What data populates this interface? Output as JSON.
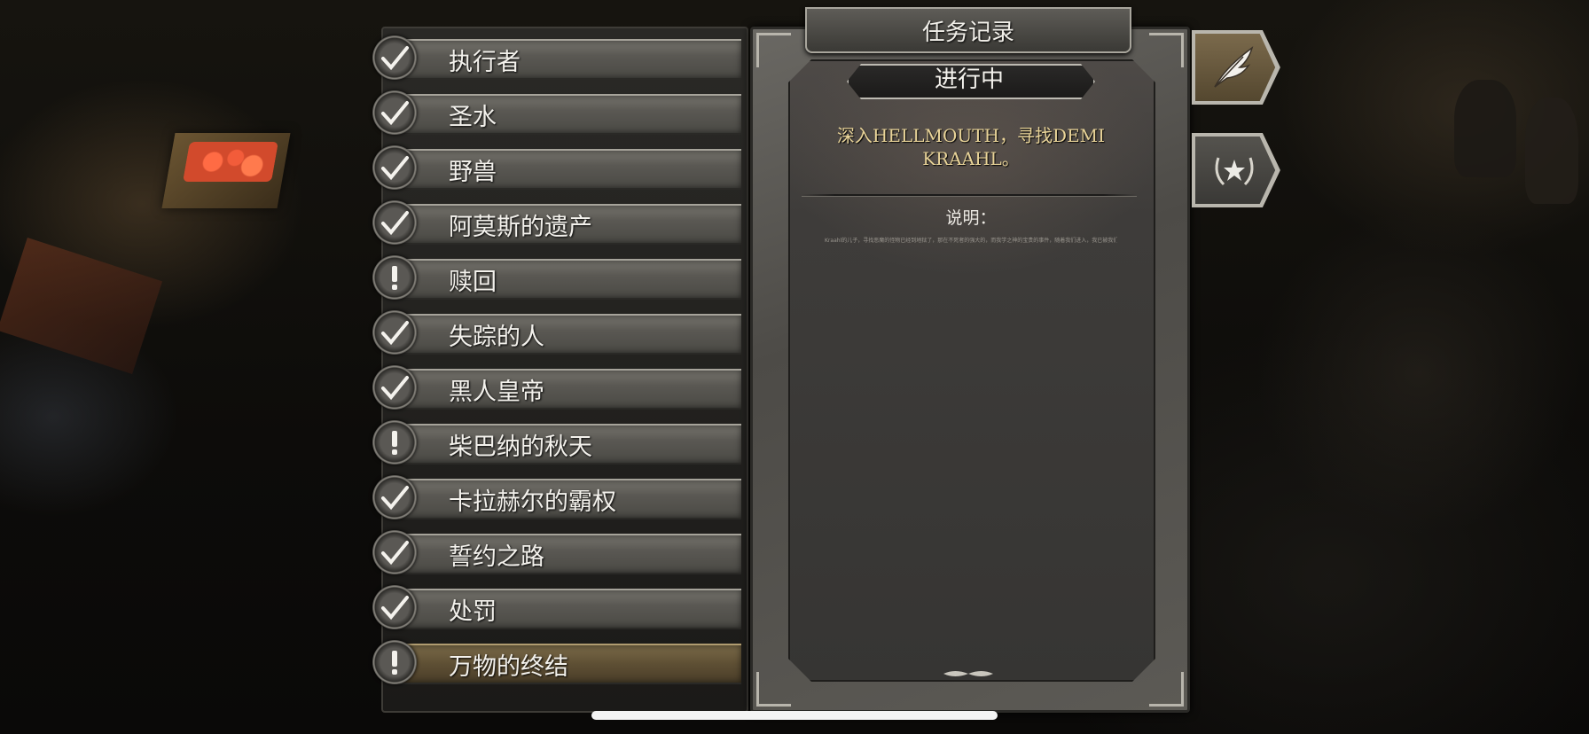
{
  "window": {
    "title": "任务记录"
  },
  "quests": [
    {
      "label": "执行者",
      "status": "completed"
    },
    {
      "label": "圣水",
      "status": "completed"
    },
    {
      "label": "野兽",
      "status": "completed"
    },
    {
      "label": "阿莫斯的遗产",
      "status": "completed"
    },
    {
      "label": "赎回",
      "status": "active"
    },
    {
      "label": "失踪的人",
      "status": "completed"
    },
    {
      "label": "黑人皇帝",
      "status": "completed"
    },
    {
      "label": "柴巴纳的秋天",
      "status": "active"
    },
    {
      "label": "卡拉赫尔的霸权",
      "status": "completed"
    },
    {
      "label": "誓约之路",
      "status": "completed"
    },
    {
      "label": "处罚",
      "status": "completed"
    },
    {
      "label": "万物的终结",
      "status": "active",
      "selected": true
    }
  ],
  "detail": {
    "status": "进行中",
    "objective_line1": "深入HELLMOUTH，寻找DEMI",
    "objective_line2": "KRAAHL。",
    "description_label": "说明：",
    "description_text": "Kraahl的儿子，寻找恶魔的怪物已经到地狱了，那在不死者的强大的，而我学之神的宝贵的事件，随着我们进入，我已被我们发动了魔法的结局发生了。"
  },
  "tabs": [
    {
      "name": "journal",
      "icon": "quill-icon",
      "active": true
    },
    {
      "name": "honors",
      "icon": "laurel-star-icon",
      "active": false
    }
  ],
  "colors": {
    "objective_text": "#e8d398",
    "selected_row": "#5e4f34",
    "panel_stone": "#4d4b47"
  }
}
